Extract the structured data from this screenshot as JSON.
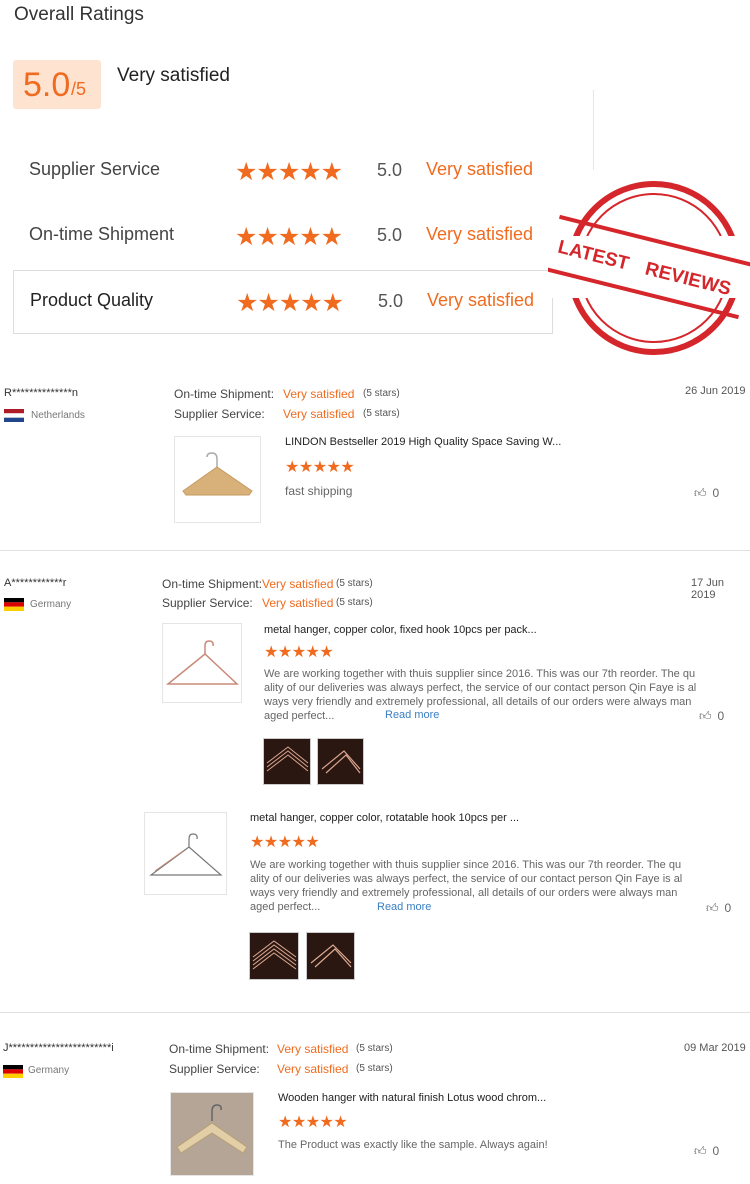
{
  "header": {
    "title": "Overall Ratings",
    "score": "5.0",
    "score_max": "/5",
    "overall_label": "Very satisfied"
  },
  "ratings": [
    {
      "label": "Supplier Service",
      "stars": "★★★★★",
      "value": "5.0",
      "text": "Very satisfied"
    },
    {
      "label": "On-time Shipment",
      "stars": "★★★★★",
      "value": "5.0",
      "text": "Very satisfied"
    },
    {
      "label": "Product Quality",
      "stars": "★★★★★",
      "value": "5.0",
      "text": "Very satisfied"
    }
  ],
  "stamp": {
    "line1": "LATEST",
    "line2": "REVIEWS"
  },
  "reviews": [
    {
      "name": "R**************n",
      "country": "Netherlands",
      "date": "26 Jun 2019",
      "shipment_label": "On-time Shipment:",
      "shipment_value": "Very satisfied",
      "shipment_stars": "(5 stars)",
      "service_label": "Supplier Service:",
      "service_value": "Very satisfied",
      "service_stars": "(5 stars)",
      "products": [
        {
          "title": "LINDON Bestseller 2019 High Quality Space Saving W...",
          "stars": "★★★★★",
          "comment": "fast shipping",
          "likes": "0"
        }
      ]
    },
    {
      "name": "A************r",
      "country": "Germany",
      "date": "17 Jun 2019",
      "shipment_label": "On-time Shipment:",
      "shipment_value": "Very satisfied",
      "shipment_stars": "(5 stars)",
      "service_label": "Supplier Service:",
      "service_value": "Very satisfied",
      "service_stars": "(5 stars)",
      "products": [
        {
          "title": "metal hanger, copper color, fixed hook 10pcs per pack...",
          "stars": "★★★★★",
          "comment_lines": [
            "We are working together with thuis supplier since 2016. This was our 7th reorder. The qu",
            "ality of our deliveries was always perfect, the service of our contact person Qin Faye is al",
            "ways very friendly and extremely professional, all details of our orders were always man",
            "aged perfect..."
          ],
          "read_more": "Read more",
          "likes": "0"
        },
        {
          "title": "metal hanger, copper color, rotatable hook 10pcs per ...",
          "stars": "★★★★★",
          "comment_lines": [
            "We are working together with thuis supplier since 2016. This was our 7th reorder. The qu",
            "ality of our deliveries was always perfect, the service of our contact person Qin Faye is al",
            "ways very friendly and extremely professional, all details of our orders were always man",
            "aged perfect..."
          ],
          "read_more": "Read more",
          "likes": "0"
        }
      ]
    },
    {
      "name": "J************************i",
      "country": "Germany",
      "date": "09 Mar 2019",
      "shipment_label": "On-time Shipment:",
      "shipment_value": "Very satisfied",
      "shipment_stars": "(5 stars)",
      "service_label": "Supplier Service:",
      "service_value": "Very satisfied",
      "service_stars": "(5 stars)",
      "products": [
        {
          "title": "Wooden hanger with natural finish Lotus wood chrom...",
          "stars": "★★★★★",
          "comment": "The Product was exactly like the sample. Always again!",
          "likes": "0"
        }
      ]
    }
  ]
}
